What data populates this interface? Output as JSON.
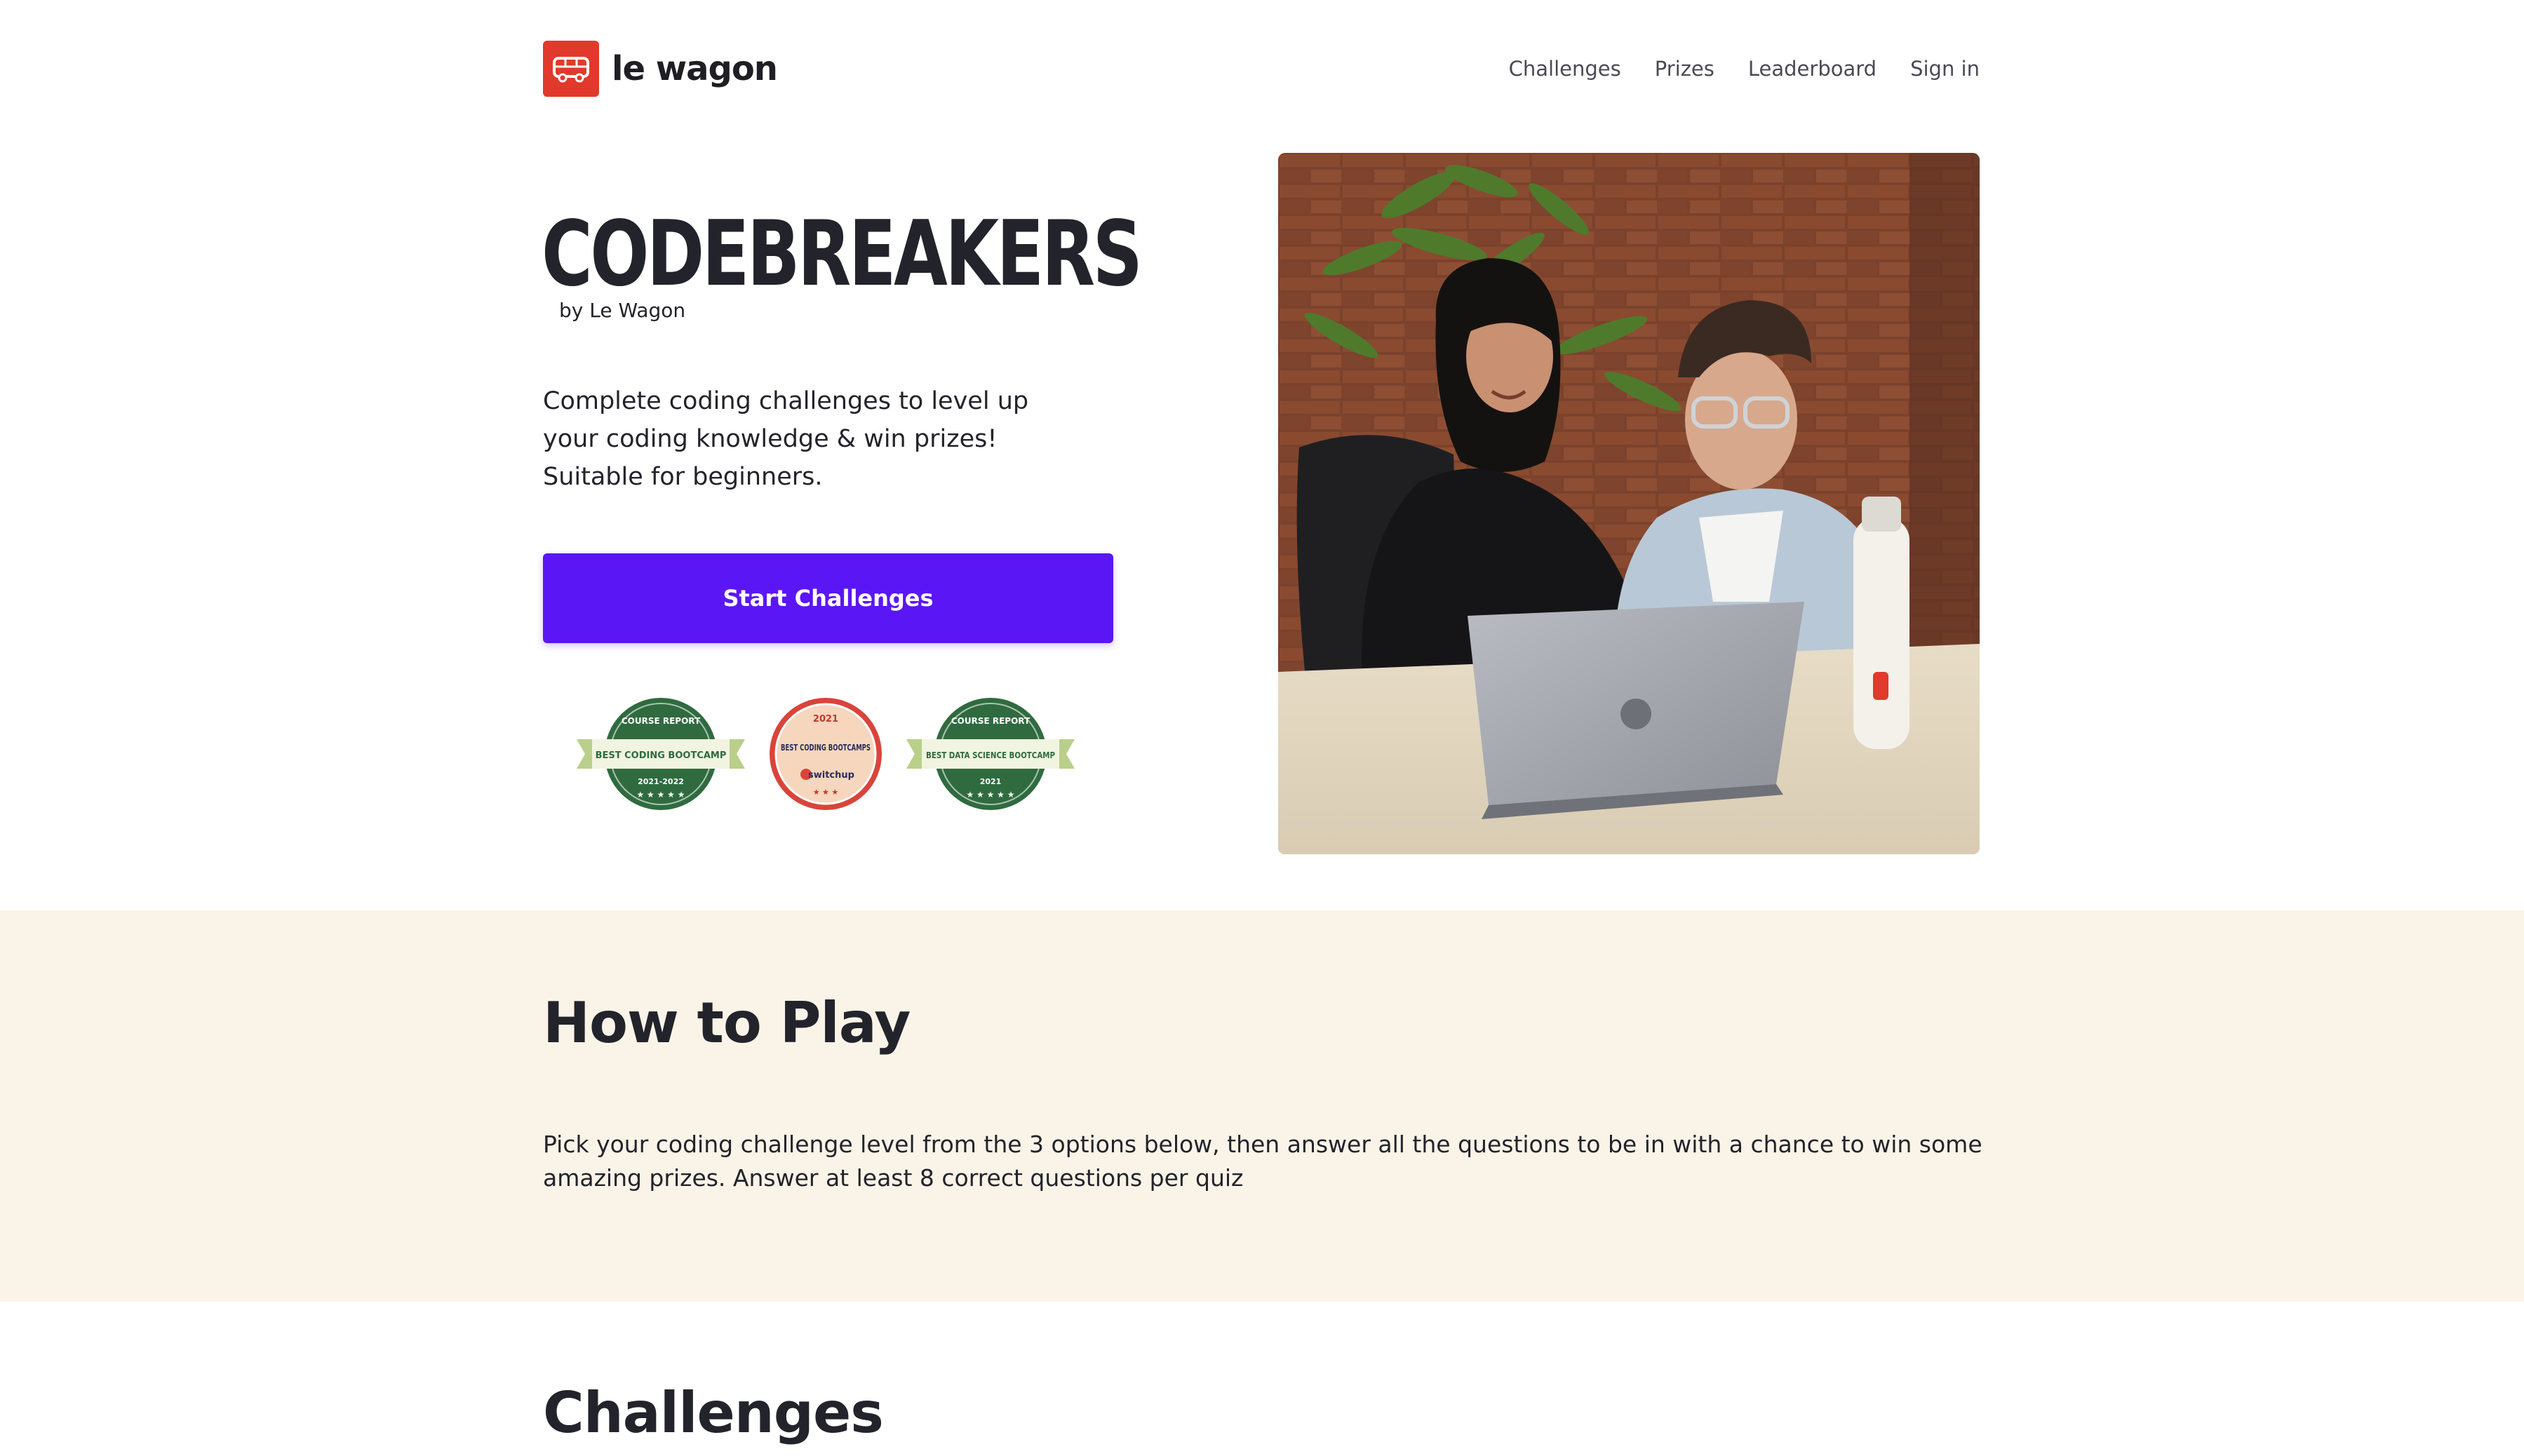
{
  "header": {
    "brand": "le wagon",
    "nav": [
      {
        "label": "Challenges"
      },
      {
        "label": "Prizes"
      },
      {
        "label": "Leaderboard"
      },
      {
        "label": "Sign in"
      }
    ]
  },
  "hero": {
    "title": "CODEBREAKERS",
    "byline": "by Le Wagon",
    "description": "Complete coding challenges to level up your coding knowledge & win prizes! Suitable for beginners.",
    "cta_label": "Start Challenges",
    "badges": [
      {
        "top": "COURSE REPORT",
        "ribbon": "BEST CODING BOOTCAMP",
        "bottom": "2021-2022"
      },
      {
        "top": "2021",
        "ribbon": "BEST CODING BOOTCAMPS",
        "bottom": "switchup"
      },
      {
        "top": "COURSE REPORT",
        "ribbon": "BEST DATA SCIENCE BOOTCAMP",
        "bottom": "2021"
      }
    ],
    "photo_icon": "people-at-laptop-photo"
  },
  "how_to_play": {
    "title": "How to Play",
    "text": "Pick your coding challenge level from the 3 options below, then answer all the questions to be in with a chance to win some amazing prizes. Answer at least 8 correct questions per quiz"
  },
  "challenges": {
    "title": "Challenges"
  },
  "colors": {
    "brand_red": "#e1392b",
    "cta_purple": "#5b16f5",
    "section_beige": "#faf4e8",
    "badge_green": "#2f6b3f",
    "badge_ribbon": "#b9cf8a"
  }
}
